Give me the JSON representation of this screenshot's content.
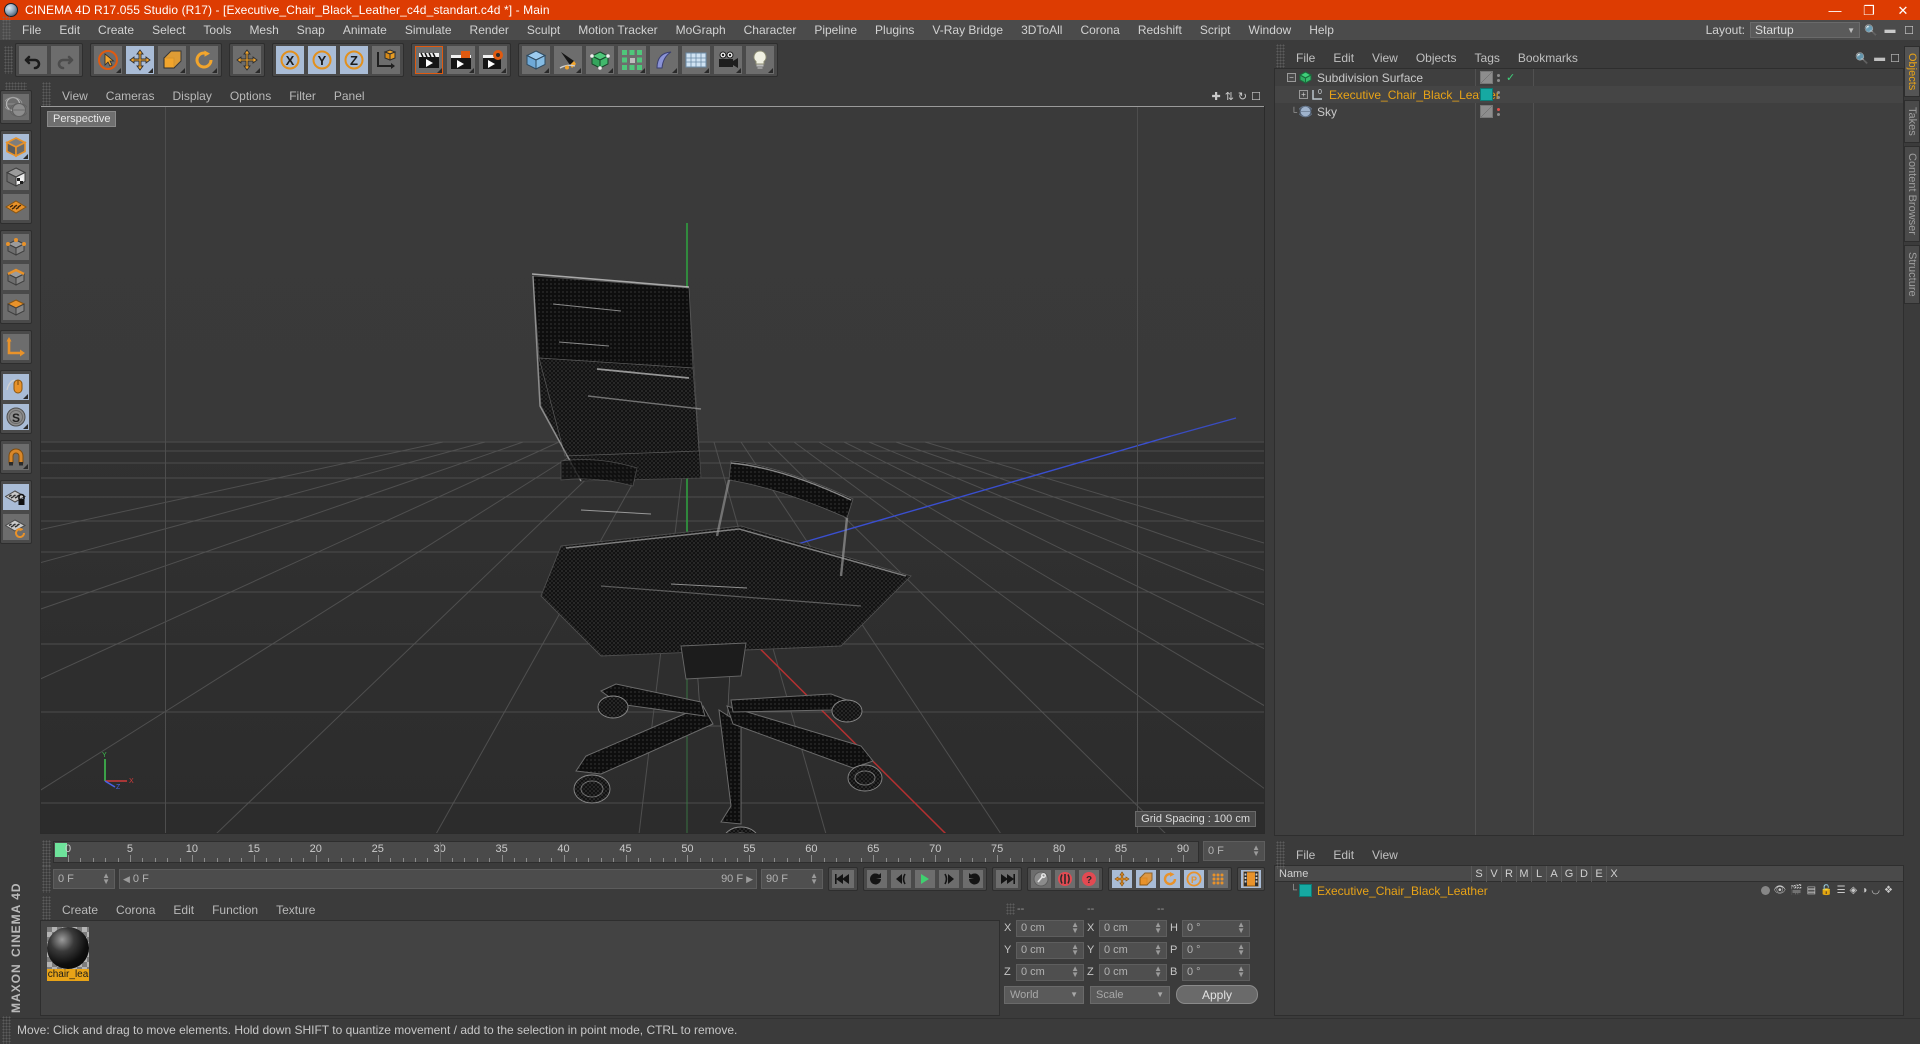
{
  "titlebar": {
    "text": "CINEMA 4D R17.055 Studio (R17) - [Executive_Chair_Black_Leather_c4d_standart.c4d *] - Main",
    "minimize": "—",
    "maximize": "❐",
    "close": "✕",
    "bg": "#dd3c02"
  },
  "menubar": {
    "items": [
      "File",
      "Edit",
      "Create",
      "Select",
      "Tools",
      "Mesh",
      "Snap",
      "Animate",
      "Simulate",
      "Render",
      "Sculpt",
      "Motion Tracker",
      "MoGraph",
      "Character",
      "Pipeline",
      "Plugins",
      "V-Ray Bridge",
      "3DToAll",
      "Corona",
      "Redshift",
      "Script",
      "Window",
      "Help"
    ],
    "layout_label": "Layout:",
    "layout_value": "Startup"
  },
  "viewport": {
    "menu": [
      "View",
      "Cameras",
      "Display",
      "Options",
      "Filter",
      "Panel"
    ],
    "tag": "Perspective",
    "grid_spacing": "Grid Spacing : 100 cm",
    "axis": {
      "x": "X",
      "y": "Y",
      "z": "Z"
    }
  },
  "timeline": {
    "ticks": [
      0,
      5,
      10,
      15,
      20,
      25,
      30,
      35,
      40,
      45,
      50,
      55,
      60,
      65,
      70,
      75,
      80,
      85,
      90
    ],
    "start": "0 F",
    "current": "0 F",
    "end": "90 F",
    "end_right": "90 F",
    "range_left": "0 F",
    "range_right": "90 F"
  },
  "material_manager": {
    "menu": [
      "Create",
      "Corona",
      "Edit",
      "Function",
      "Texture"
    ],
    "material_name": "chair_lea"
  },
  "coordinates": {
    "headers": [
      "--",
      "--",
      "--"
    ],
    "rows": [
      {
        "label1": "X",
        "value1": "0 cm",
        "label2": "X",
        "value2": "0 cm",
        "label3": "H",
        "value3": "0 °"
      },
      {
        "label1": "Y",
        "value1": "0 cm",
        "label2": "Y",
        "value2": "0 cm",
        "label3": "P",
        "value3": "0 °"
      },
      {
        "label1": "Z",
        "value1": "0 cm",
        "label2": "Z",
        "value2": "0 cm",
        "label3": "B",
        "value3": "0 °"
      }
    ],
    "system": "World",
    "mode": "Scale",
    "apply": "Apply"
  },
  "object_manager": {
    "menu": [
      "File",
      "Edit",
      "View",
      "Objects",
      "Tags",
      "Bookmarks"
    ],
    "objects": [
      {
        "name": "Subdivision Surface",
        "indent": 0,
        "selected": false,
        "icon": "subdivision-surface-icon"
      },
      {
        "name": "Executive_Chair_Black_Leather",
        "indent": 1,
        "selected": true,
        "icon": "null-object-icon"
      },
      {
        "name": "Sky",
        "indent": 1,
        "selected": false,
        "icon": "sky-icon"
      }
    ]
  },
  "material_list": {
    "menu": [
      "File",
      "Edit",
      "View"
    ],
    "columns": [
      "Name",
      "S",
      "V",
      "R",
      "M",
      "L",
      "A",
      "G",
      "D",
      "E",
      "X"
    ],
    "rows": [
      {
        "name": "Executive_Chair_Black_Leather",
        "swatch": "#16a9a2"
      }
    ]
  },
  "right_tabs": [
    {
      "label": "Objects",
      "active": true
    },
    {
      "label": "Takes",
      "active": false
    },
    {
      "label": "Content Browser",
      "active": false
    },
    {
      "label": "Structure",
      "active": false
    }
  ],
  "statusbar": {
    "text": "Move: Click and drag to move elements. Hold down SHIFT to quantize movement / add to the selection in point mode, CTRL to remove."
  },
  "branding": {
    "maxon": "MAXON",
    "cinema4d": "CINEMA 4D"
  },
  "colors": {
    "accent_orange": "#dd3c02",
    "selected_text": "#e8a317",
    "panel_bg": "#3b3b3b",
    "active_tool": "#a9bcd6",
    "teal_swatch": "#16a9a2"
  }
}
